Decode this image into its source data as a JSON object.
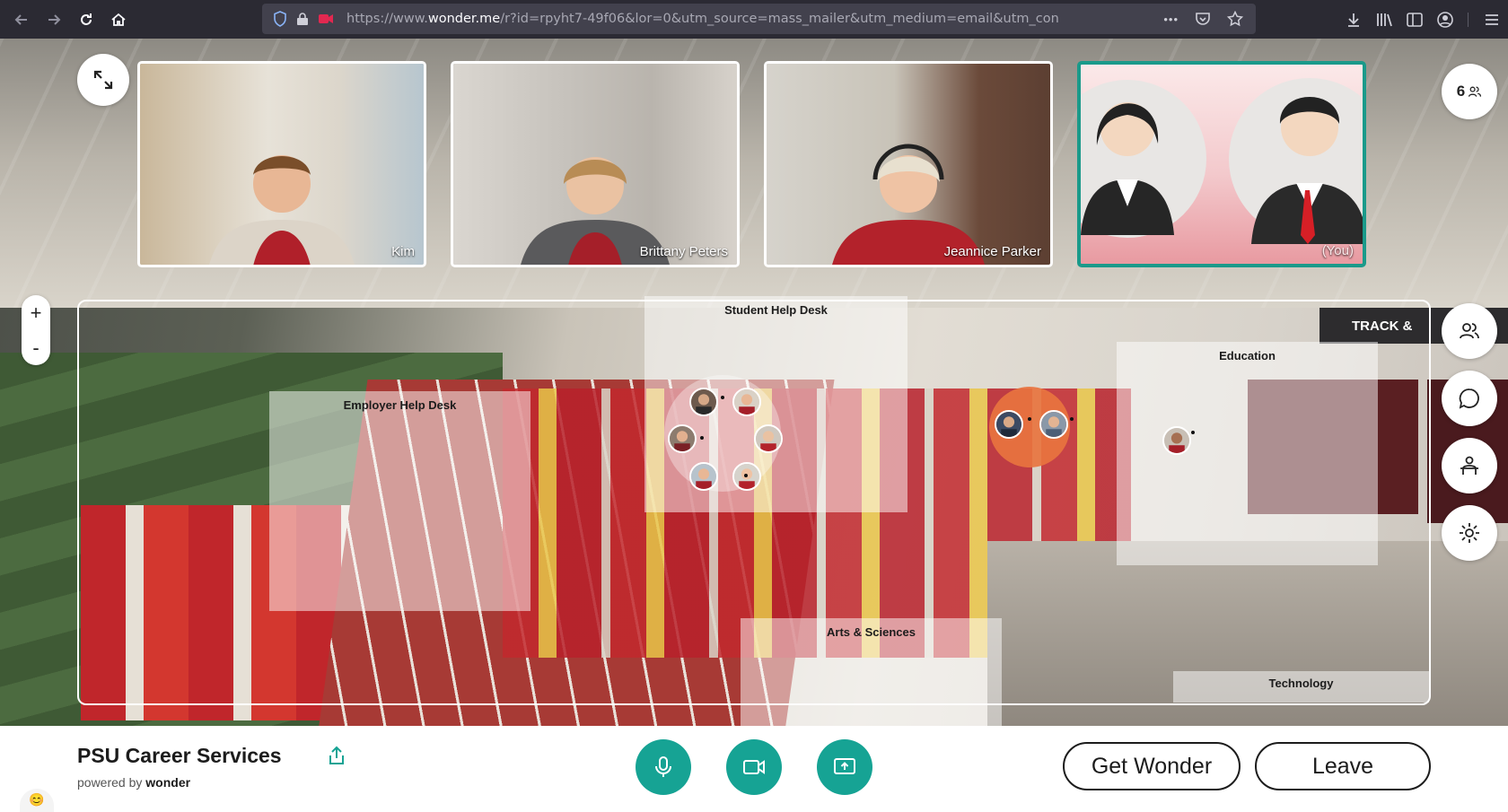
{
  "browser": {
    "url_prefix": "https://www.",
    "url_domain": "wonder.me",
    "url_suffix": "/r?id=rpyht7-49f06&lor=0&utm_source=mass_mailer&utm_medium=email&utm_con",
    "more_label": "•••"
  },
  "participants_count": "6",
  "video_tiles": [
    {
      "name": "Kim"
    },
    {
      "name": "Brittany Peters"
    },
    {
      "name": "Jeannice Parker"
    },
    {
      "name": "(You)"
    }
  ],
  "zoom": {
    "plus": "+",
    "minus": "-"
  },
  "rooms": {
    "student_help_desk": "Student Help Desk",
    "employer_help_desk": "Employer Help Desk",
    "education": "Education",
    "arts_sciences": "Arts & Sciences",
    "technology": "Technology"
  },
  "venue_banner": "TRACK &",
  "space": {
    "title": "PSU Career Services",
    "powered_prefix": "powered by",
    "powered_brand": "wonder"
  },
  "buttons": {
    "get_wonder": "Get Wonder",
    "leave": "Leave"
  },
  "colors": {
    "accent": "#16a394",
    "you_border": "#1a9a8a",
    "group_circle": "#e8743f"
  }
}
